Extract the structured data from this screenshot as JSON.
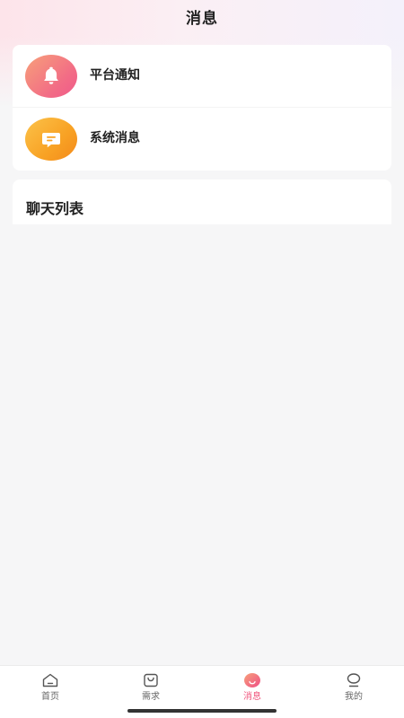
{
  "header": {
    "title": "消息"
  },
  "notices": [
    {
      "label": "平台通知",
      "icon": "bell-icon"
    },
    {
      "label": "系统消息",
      "icon": "message-icon"
    }
  ],
  "chat": {
    "title": "聊天列表"
  },
  "tabbar": {
    "items": [
      {
        "label": "首页",
        "icon": "home-icon"
      },
      {
        "label": "需求",
        "icon": "bag-icon"
      },
      {
        "label": "消息",
        "icon": "message-bubble-icon",
        "active": true
      },
      {
        "label": "我的",
        "icon": "profile-icon"
      }
    ],
    "active_color": "#f0557d"
  }
}
